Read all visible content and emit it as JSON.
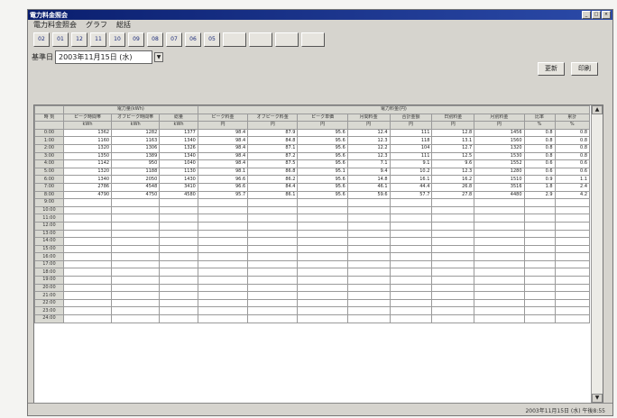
{
  "window": {
    "title": "電力料金照会"
  },
  "menu": [
    "電力料金照会",
    "グラフ",
    "総括"
  ],
  "toolbar": [
    "02",
    "01",
    "12",
    "11",
    "10",
    "09",
    "08",
    "07",
    "06",
    "05"
  ],
  "toolbar_disabled": [
    "",
    "",
    "",
    ""
  ],
  "date": {
    "label": "基準日",
    "value": "2003年11月15日 (水)",
    "dropdown": "▼"
  },
  "actions": {
    "refresh": "更新",
    "print": "印刷"
  },
  "table": {
    "group_header_1": "電力量(kWh)",
    "group_header_2": "電力料金(円)",
    "headers": [
      "時 刻",
      "ピーク時間帯",
      "オフピーク時間帯",
      "総量",
      "ピーク料金",
      "オフピーク料金",
      "ピーク単価",
      "月間料金",
      "合計金額",
      "日別料金",
      "月別料金",
      "比率",
      "累計"
    ],
    "units": [
      "",
      "kWh",
      "kWh",
      "kWh",
      "円",
      "円",
      "円",
      "円",
      "円",
      "円",
      "円",
      "%",
      "%"
    ],
    "rows": [
      [
        "0:00",
        "1362",
        "1282",
        "1377",
        "98.4",
        "87.9",
        "95.6",
        "12.4",
        "111",
        "12.8",
        "1456",
        "0.8",
        "0.8"
      ],
      [
        "1:00",
        "1160",
        "1163",
        "1340",
        "98.4",
        "84.8",
        "95.6",
        "12.3",
        "118",
        "13.1",
        "1560",
        "0.8",
        "0.8"
      ],
      [
        "2:00",
        "1320",
        "1306",
        "1326",
        "98.4",
        "87.1",
        "95.6",
        "12.2",
        "104",
        "12.7",
        "1320",
        "0.8",
        "0.8"
      ],
      [
        "3:00",
        "1350",
        "1389",
        "1340",
        "98.4",
        "87.2",
        "95.6",
        "12.3",
        "111",
        "12.5",
        "1530",
        "0.8",
        "0.8"
      ],
      [
        "4:00",
        "1142",
        "950",
        "1040",
        "98.4",
        "87.5",
        "95.6",
        "7.1",
        "9.1",
        "9.6",
        "1552",
        "0.6",
        "0.6"
      ],
      [
        "5:00",
        "1320",
        "1188",
        "1130",
        "98.1",
        "86.8",
        "95.1",
        "9.4",
        "10.2",
        "12.3",
        "1280",
        "0.6",
        "0.6"
      ],
      [
        "6:00",
        "1340",
        "2050",
        "1430",
        "96.6",
        "86.2",
        "95.6",
        "14.8",
        "16.1",
        "16.2",
        "1510",
        "0.9",
        "1.1"
      ],
      [
        "7:00",
        "2786",
        "4548",
        "3410",
        "96.6",
        "84.4",
        "95.6",
        "46.1",
        "44.4",
        "26.8",
        "3516",
        "1.8",
        "2.4"
      ],
      [
        "8:00",
        "4790",
        "4750",
        "4580",
        "95.7",
        "86.1",
        "95.6",
        "59.6",
        "57.7",
        "27.8",
        "4480",
        "2.9",
        "4.2"
      ]
    ],
    "empty_row_times": [
      "9:00",
      "10:00",
      "11:00",
      "12:00",
      "13:00",
      "14:00",
      "15:00",
      "16:00",
      "17:00",
      "18:00",
      "19:00",
      "20:00",
      "21:00",
      "22:00",
      "23:00",
      "24:00"
    ]
  },
  "status": {
    "datetime": "2003年11月15日 (水) 午後8:55"
  },
  "icons": {
    "minimize": "minimize-icon",
    "maximize": "maximize-icon",
    "close": "close-icon",
    "dropdown": "chevron-down-icon",
    "scroll_up": "arrow-up-icon",
    "scroll_down": "arrow-down-icon"
  }
}
